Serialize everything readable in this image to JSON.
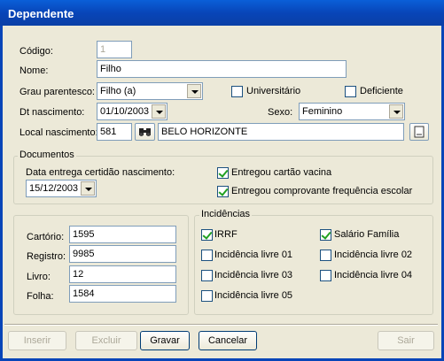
{
  "window": {
    "title": "Dependente"
  },
  "form": {
    "codigo_label": "Código:",
    "codigo_value": "1",
    "nome_label": "Nome:",
    "nome_value": "Filho",
    "grau_label": "Grau parentesco:",
    "grau_value": "Filho (a)",
    "universitario_label": "Universitário",
    "universitario_checked": false,
    "deficiente_label": "Deficiente",
    "deficiente_checked": false,
    "dt_nasc_label": "Dt nascimento:",
    "dt_nasc_value": "01/10/2003",
    "sexo_label": "Sexo:",
    "sexo_value": "Feminino",
    "local_label": "Local nascimento:",
    "local_code": "581",
    "local_name": "BELO HORIZONTE"
  },
  "documentos": {
    "title": "Documentos",
    "data_entrega_label": "Data entrega certidão nascimento:",
    "data_entrega_value": "15/12/2003",
    "vacina_label": "Entregou cartão vacina",
    "vacina_checked": true,
    "escolar_label": "Entregou comprovante frequência escolar",
    "escolar_checked": true
  },
  "registro": {
    "cartorio_label": "Cartório:",
    "cartorio_value": "1595",
    "registro_label": "Registro:",
    "registro_value": "9985",
    "livro_label": "Livro:",
    "livro_value": "12",
    "folha_label": "Folha:",
    "folha_value": "1584"
  },
  "incidencias": {
    "title": "Incidências",
    "items": [
      {
        "label": "IRRF",
        "checked": true
      },
      {
        "label": "Salário Família",
        "checked": true
      },
      {
        "label": "Incidência livre 01",
        "checked": false
      },
      {
        "label": "Incidência livre 02",
        "checked": false
      },
      {
        "label": "Incidência livre 03",
        "checked": false
      },
      {
        "label": "Incidência livre 04",
        "checked": false
      },
      {
        "label": "Incidência livre 05",
        "checked": false
      }
    ]
  },
  "buttons": {
    "inserir": "Inserir",
    "excluir": "Excluir",
    "gravar": "Gravar",
    "cancelar": "Cancelar",
    "sair": "Sair"
  },
  "icons": {
    "search": "binoculars-icon",
    "lookup": "document-icon"
  }
}
